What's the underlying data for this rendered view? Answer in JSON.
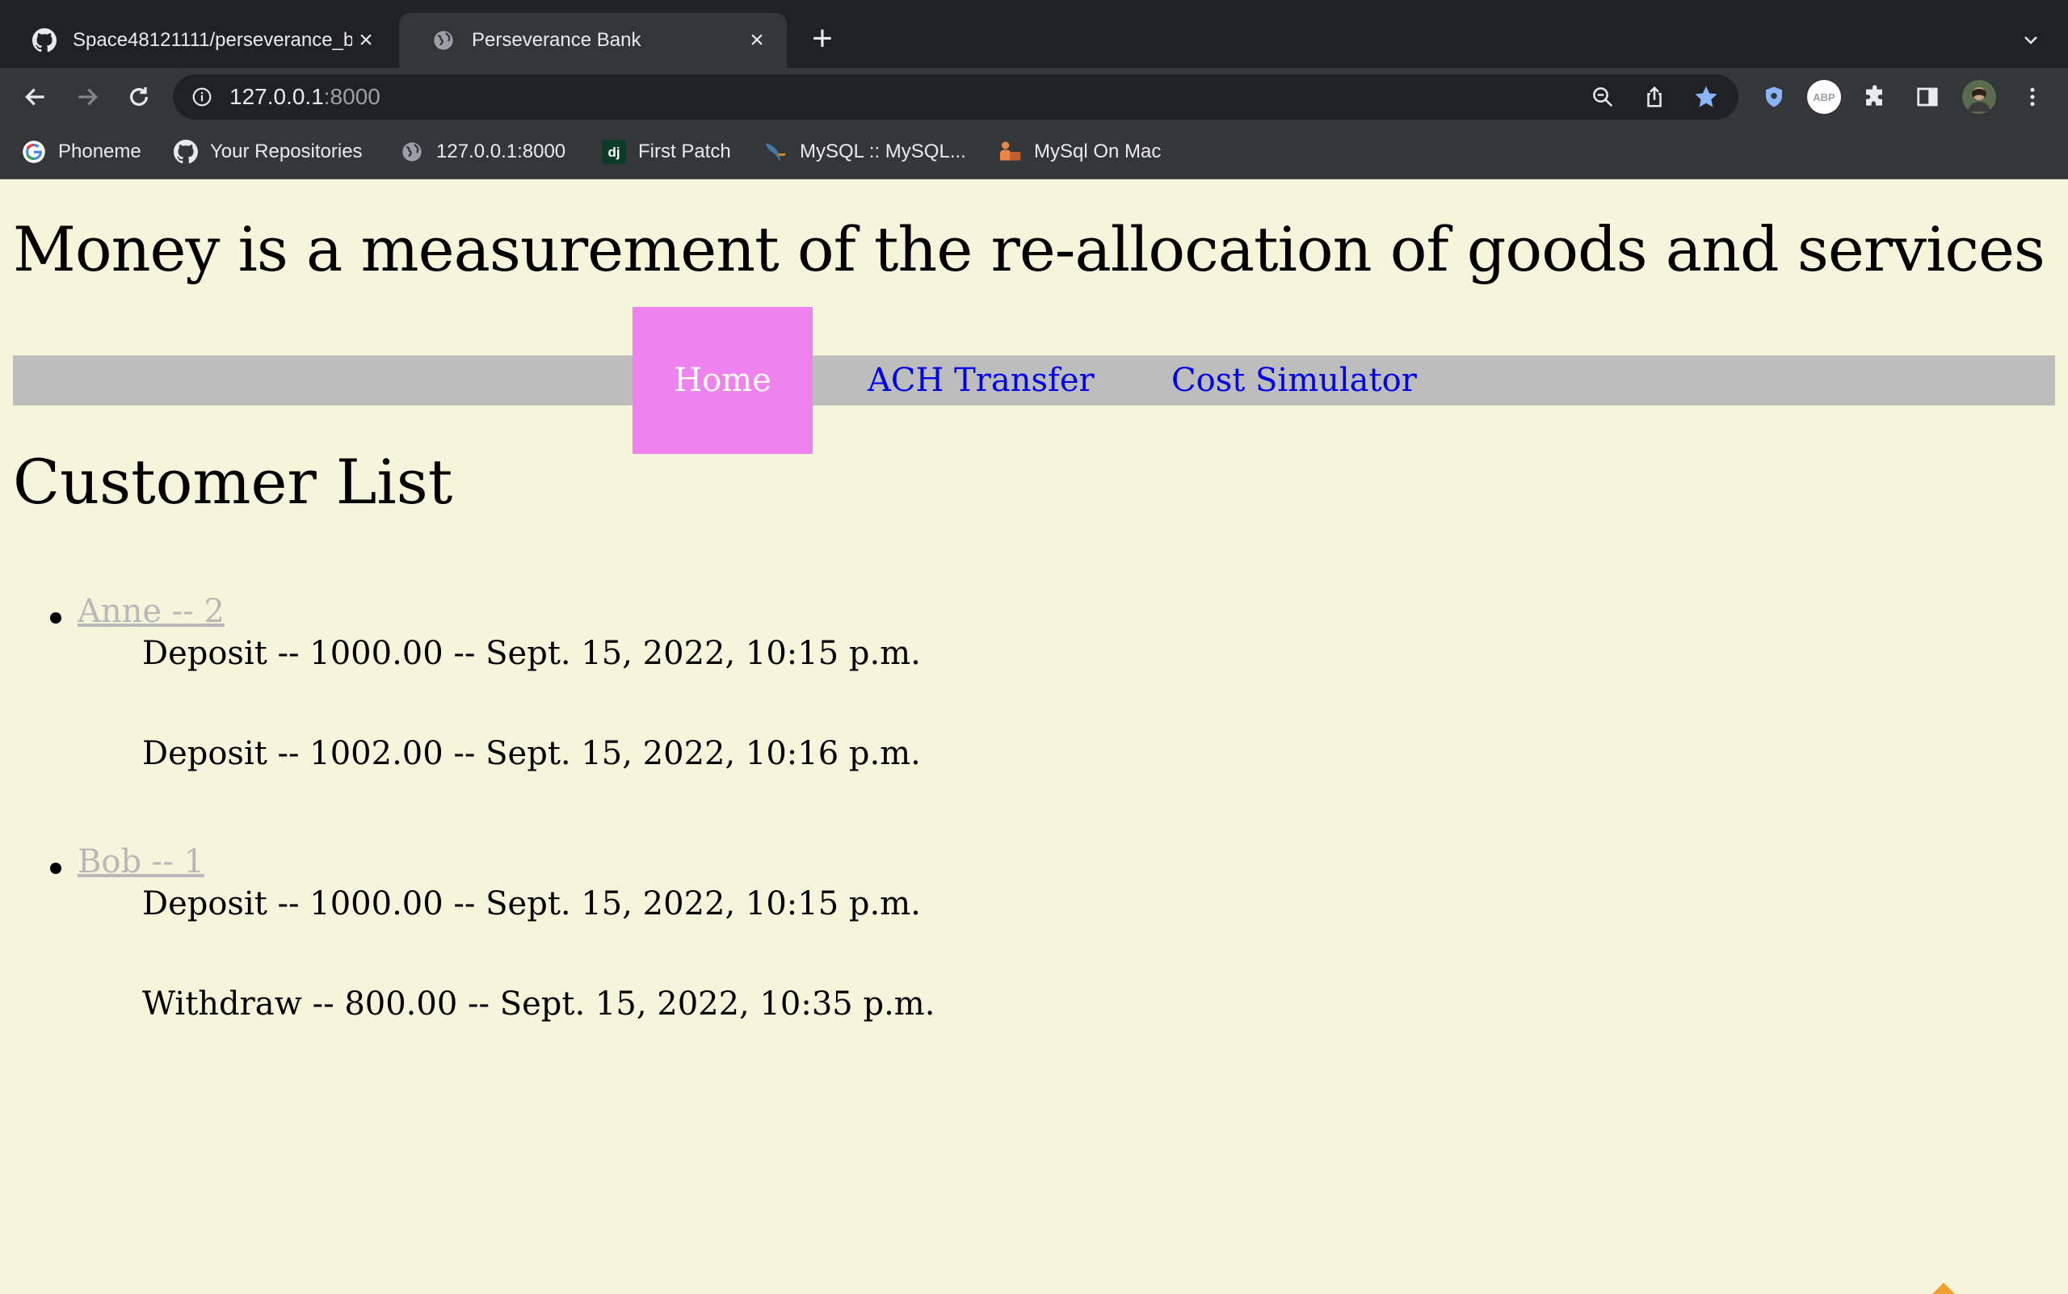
{
  "browser": {
    "tabs": [
      {
        "title": "Space48121111/perseverance_b",
        "icon": "github-icon",
        "active": false
      },
      {
        "title": "Perseverance Bank",
        "icon": "globe-icon",
        "active": true
      }
    ],
    "new_tab_label": "+",
    "address": {
      "host": "127.0.0.1",
      "port": ":8000"
    },
    "bookmarks": [
      {
        "label": "Phoneme",
        "icon": "google-icon"
      },
      {
        "label": "Your Repositories",
        "icon": "github-icon"
      },
      {
        "label": "127.0.0.1:8000",
        "icon": "globe-icon"
      },
      {
        "label": "First Patch",
        "icon": "django-icon"
      },
      {
        "label": "MySQL :: MySQL...",
        "icon": "mysql-dolphin-icon"
      },
      {
        "label": "MySql On Mac",
        "icon": "mysql-mac-icon"
      }
    ],
    "colors": {
      "tabbar": "#202124",
      "toolbar": "#35363a",
      "bookmark_star": "#8ab4f8"
    }
  },
  "page": {
    "site_title": "Money is a measurement of the re-allocation of goods and services",
    "nav": {
      "items": [
        {
          "label": "Home",
          "active": true
        },
        {
          "label": "ACH Transfer",
          "active": false
        },
        {
          "label": "Cost Simulator",
          "active": false
        }
      ]
    },
    "section_heading": "Customer List",
    "customers": [
      {
        "link": "Anne -- 2",
        "transactions": [
          "Deposit -- 1000.00 -- Sept. 15, 2022, 10:15 p.m.",
          "Deposit -- 1002.00 -- Sept. 15, 2022, 10:16 p.m."
        ]
      },
      {
        "link": "Bob -- 1",
        "transactions": [
          "Deposit -- 1000.00 -- Sept. 15, 2022, 10:15 p.m.",
          "Withdraw -- 800.00 -- Sept. 15, 2022, 10:35 p.m."
        ]
      }
    ],
    "colors": {
      "background": "#f5f5dc",
      "navbar": "#bdbdbd",
      "active_nav": "#ee82ee",
      "link": "#0000ee",
      "customer_link": "#b8b8b8"
    }
  }
}
